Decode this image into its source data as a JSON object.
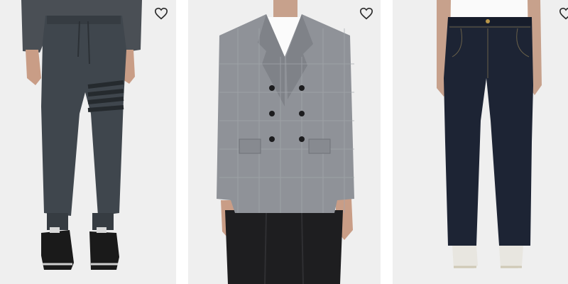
{
  "products": [
    {
      "photo_icon": "grey-jogger-pants-photo",
      "favorite_icon": "heart-outline-icon"
    },
    {
      "photo_icon": "grey-check-double-breasted-blazer-photo",
      "favorite_icon": "heart-outline-icon"
    },
    {
      "photo_icon": "raw-denim-jeans-photo",
      "favorite_icon": "heart-outline-icon"
    }
  ],
  "colors": {
    "card_background": "#efefef",
    "heart_stroke": "#2b2b2b"
  }
}
